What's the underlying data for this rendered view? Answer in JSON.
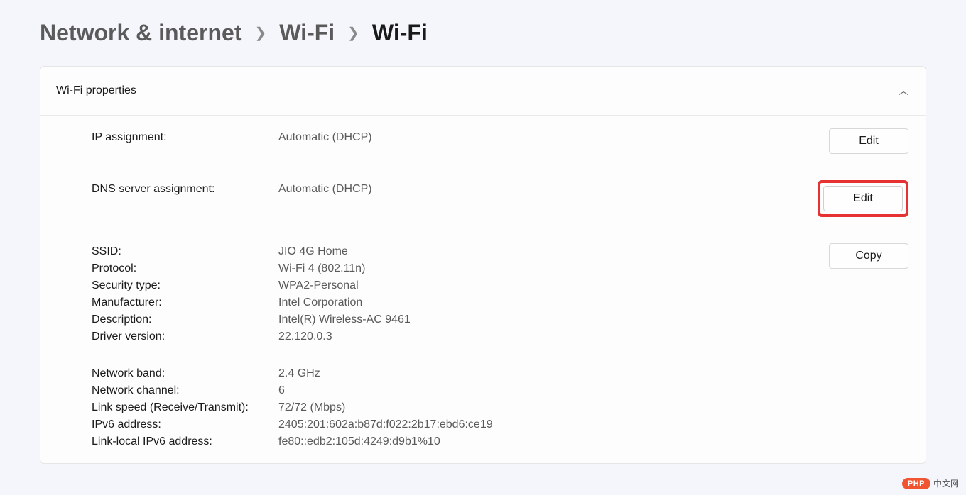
{
  "breadcrumb": {
    "root": "Network & internet",
    "mid": "Wi-Fi",
    "current": "Wi-Fi"
  },
  "panel": {
    "title": "Wi-Fi properties"
  },
  "ip": {
    "label": "IP assignment:",
    "value": "Automatic (DHCP)",
    "button": "Edit"
  },
  "dns": {
    "label": "DNS server assignment:",
    "value": "Automatic (DHCP)",
    "button": "Edit"
  },
  "copy_button": "Copy",
  "info": {
    "group1": [
      {
        "label": "SSID:",
        "value": "JIO 4G Home"
      },
      {
        "label": "Protocol:",
        "value": "Wi-Fi 4 (802.11n)"
      },
      {
        "label": "Security type:",
        "value": "WPA2-Personal"
      },
      {
        "label": "Manufacturer:",
        "value": "Intel Corporation"
      },
      {
        "label": "Description:",
        "value": "Intel(R) Wireless-AC 9461"
      },
      {
        "label": "Driver version:",
        "value": "22.120.0.3"
      }
    ],
    "group2": [
      {
        "label": "Network band:",
        "value": "2.4 GHz"
      },
      {
        "label": "Network channel:",
        "value": "6"
      },
      {
        "label": "Link speed (Receive/Transmit):",
        "value": "72/72 (Mbps)"
      },
      {
        "label": "IPv6 address:",
        "value": "2405:201:602a:b87d:f022:2b17:ebd6:ce19"
      },
      {
        "label": "Link-local IPv6 address:",
        "value": "fe80::edb2:105d:4249:d9b1%10"
      }
    ]
  },
  "watermark": {
    "pill": "PHP",
    "text": "中文网"
  }
}
